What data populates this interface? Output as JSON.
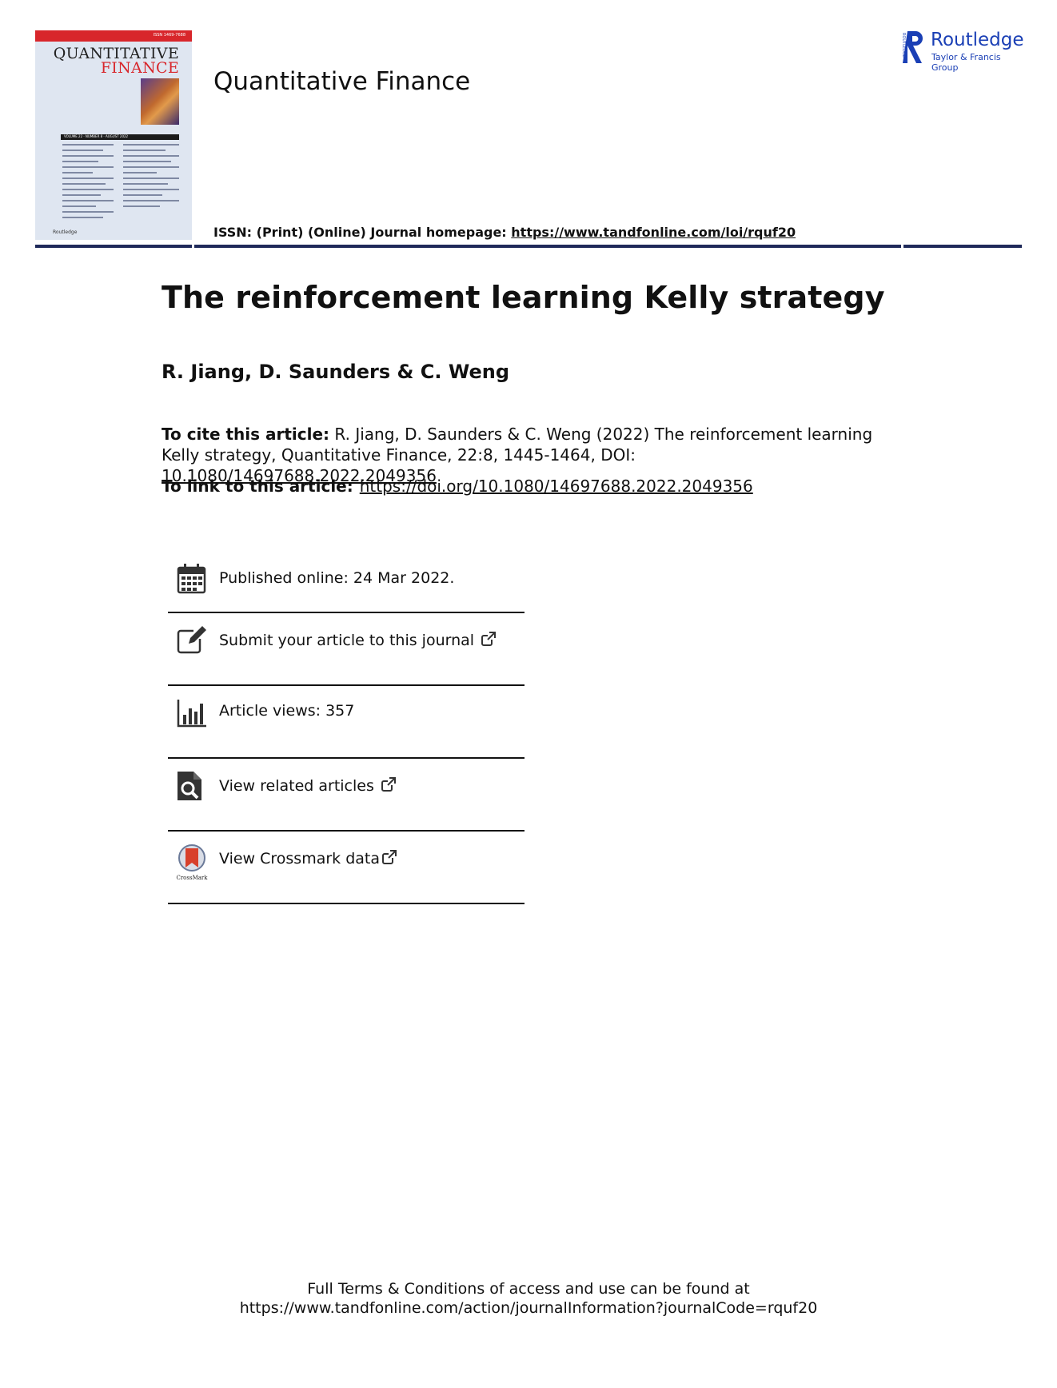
{
  "cover": {
    "issn_mini": "ISSN 1469-7688",
    "title_line1": "QUANTITATIVE",
    "title_line2": "FINANCE",
    "volume_bar": "VOLUME 22 · NUMBER 8 · AUGUST 2022",
    "publisher": "Routledge"
  },
  "header": {
    "journal_title": "Quantitative Finance",
    "issn_label": "ISSN: (Print) (Online) Journal homepage: ",
    "homepage_url": "https://www.tandfonline.com/loi/rquf20"
  },
  "brand": {
    "name": "Routledge",
    "group": "Taylor & Francis Group",
    "mark_text": "ROUTLEDGE"
  },
  "article": {
    "title": "The reinforcement learning Kelly strategy",
    "authors": "R. Jiang, D. Saunders & C. Weng",
    "cite_label": "To cite this article:",
    "cite_text": " R. Jiang, D. Saunders & C. Weng (2022) The reinforcement learning Kelly strategy, Quantitative Finance, 22:8, 1445-1464, DOI: ",
    "cite_doi": "10.1080/14697688.2022.2049356",
    "link_label": "To link to this article:",
    "link_url": "https://doi.org/10.1080/14697688.2022.2049356"
  },
  "info": {
    "published": "Published online: 24 Mar 2022.",
    "submit": "Submit your article to this journal",
    "views": "Article views: 357",
    "related": "View related articles",
    "crossmark": "View Crossmark data",
    "crossmark_caption": "CrossMark"
  },
  "footer": {
    "line1": "Full Terms & Conditions of access and use can be found at",
    "line2": "https://www.tandfonline.com/action/journalInformation?journalCode=rquf20"
  }
}
